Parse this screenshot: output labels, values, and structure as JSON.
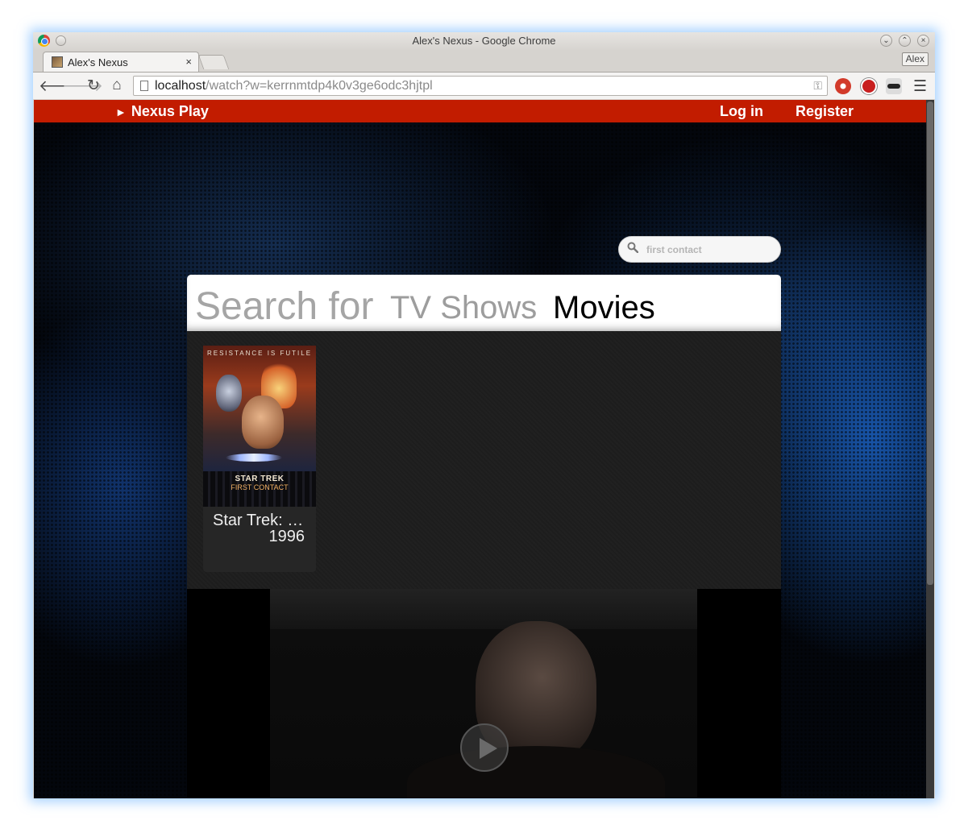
{
  "window": {
    "title": "Alex's Nexus - Google Chrome",
    "user": "Alex"
  },
  "tab": {
    "title": "Alex's Nexus",
    "close": "×"
  },
  "omnibox": {
    "host": "localhost",
    "path": "/watch?w=kerrnmtdp4k0v3ge6odc3hjtpl"
  },
  "site": {
    "brand": "Nexus Play",
    "brand_marker": "►",
    "login": "Log in",
    "register": "Register",
    "accent_color": "#c21c00"
  },
  "search": {
    "placeholder": "first contact",
    "value": ""
  },
  "panel": {
    "search_for": "Search for",
    "tabs": [
      {
        "label": "TV Shows",
        "active": false
      },
      {
        "label": "Movies",
        "active": true
      }
    ]
  },
  "results": [
    {
      "title": "Star Trek: …",
      "year": "1996",
      "poster": {
        "tagline": "RESISTANCE IS FUTILE",
        "logo_line1": "STAR TREK",
        "logo_line2": "FIRST CONTACT"
      }
    }
  ],
  "icons": {
    "back": "back-arrow-icon",
    "forward": "forward-arrow-icon",
    "reload": "reload-icon",
    "home": "home-icon",
    "search": "search-icon",
    "play": "play-icon"
  }
}
